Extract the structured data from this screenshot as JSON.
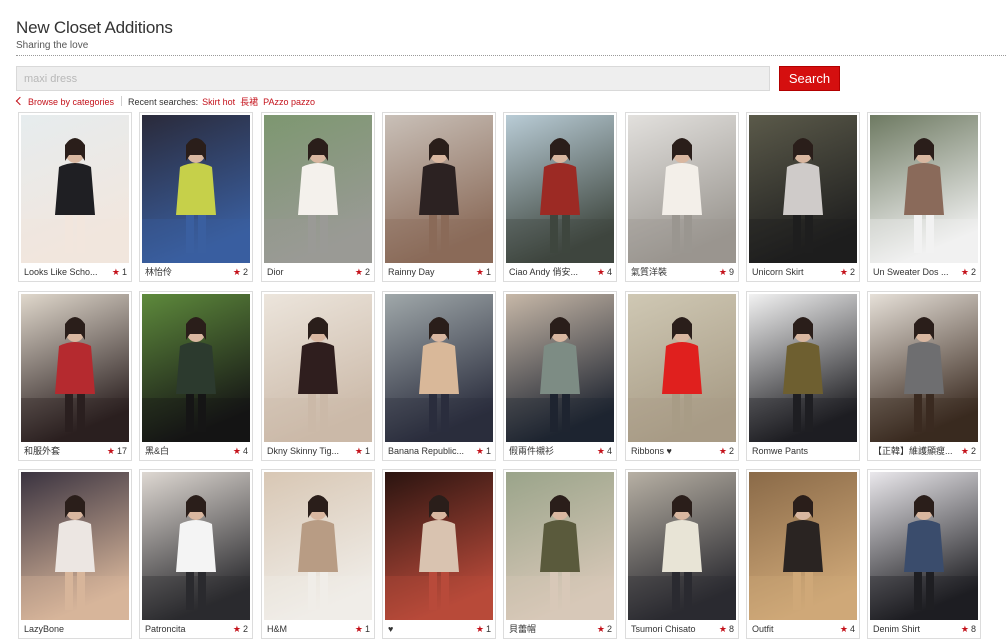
{
  "header": {
    "title": "New Closet Additions",
    "subtitle": "Sharing the love"
  },
  "search": {
    "value": "",
    "placeholder": "maxi dress",
    "button_label": "Search"
  },
  "nav": {
    "browse_label": "Browse by categories",
    "recent_label": "Recent searches:",
    "recent": [
      "Skirt hot",
      "長裙",
      "PAzzo pazzo"
    ]
  },
  "colors": {
    "accent": "#d50f0f",
    "link": "#c4121b",
    "star": "#c4121b"
  },
  "items": [
    {
      "title": "Looks Like Scho...",
      "count": "1",
      "palette": [
        "#e6ecee",
        "#1f1f23",
        "#f2e6dd"
      ]
    },
    {
      "title": "林怡伶",
      "count": "2",
      "palette": [
        "#2a2a3a",
        "#c6d04a",
        "#3a5fa0"
      ]
    },
    {
      "title": "Dior",
      "count": "2",
      "palette": [
        "#7d9770",
        "#f4f1ec",
        "#9a9a96"
      ]
    },
    {
      "title": "Rainny Day",
      "count": "1",
      "palette": [
        "#c9c0b8",
        "#2c2222",
        "#8a6a58"
      ]
    },
    {
      "title": "Ciao Andy 俏安...",
      "count": "4",
      "palette": [
        "#b9ccd6",
        "#9c2a24",
        "#3e463e"
      ]
    },
    {
      "title": "氣質洋裝",
      "count": "9",
      "palette": [
        "#e2e0dd",
        "#f3efe9",
        "#9a9690"
      ]
    },
    {
      "title": "Unicorn Skirt",
      "count": "2",
      "palette": [
        "#5b5a4a",
        "#cfcbc9",
        "#1e1e1e"
      ]
    },
    {
      "title": "Un Sweater Dos ...",
      "count": "2",
      "palette": [
        "#6e7a62",
        "#8a6a5a",
        "#f2f2f2"
      ]
    },
    {
      "title": "和服外套",
      "count": "17",
      "palette": [
        "#e0d8cc",
        "#b52a2f",
        "#2a1f1f"
      ]
    },
    {
      "title": "黑&白",
      "count": "4",
      "palette": [
        "#5e8a3c",
        "#2c3a2e",
        "#151515"
      ]
    },
    {
      "title": "Dkny Skinny Tig...",
      "count": "1",
      "palette": [
        "#ece5dc",
        "#2f1e1e",
        "#cbb9a8"
      ]
    },
    {
      "title": "Banana Republic...",
      "count": "1",
      "palette": [
        "#a0a8aa",
        "#d9b899",
        "#2a2d3d"
      ]
    },
    {
      "title": "假兩件襯衫",
      "count": "4",
      "palette": [
        "#c7b8a8",
        "#7d8c84",
        "#1e2430"
      ]
    },
    {
      "title": "Ribbons ♥",
      "count": "2",
      "palette": [
        "#cfc8b4",
        "#e0201e",
        "#a89c86"
      ]
    },
    {
      "title": "Romwe Pants",
      "count": "",
      "palette": [
        "#f2f2f2",
        "#6e5f30",
        "#1e1e22"
      ]
    },
    {
      "title": "【正韓】維護顯瘦...",
      "count": "2",
      "palette": [
        "#e6e0d8",
        "#6e6e70",
        "#3a2a20"
      ]
    },
    {
      "title": "LazyBone",
      "count": "",
      "palette": [
        "#3a3340",
        "#ece6e2",
        "#d7b59a"
      ]
    },
    {
      "title": "Patroncita",
      "count": "2",
      "palette": [
        "#ded8d2",
        "#f4f4f4",
        "#2a2a2e"
      ]
    },
    {
      "title": "H&M",
      "count": "1",
      "palette": [
        "#d8c7b4",
        "#b89c84",
        "#f0ede8"
      ]
    },
    {
      "title": "♥",
      "count": "1",
      "palette": [
        "#2a1410",
        "#d9c3b0",
        "#b84a3a"
      ]
    },
    {
      "title": "貝蕾帽",
      "count": "2",
      "palette": [
        "#9aa48a",
        "#5a5a3c",
        "#d8c8b8"
      ]
    },
    {
      "title": "Tsumori Chisato",
      "count": "8",
      "palette": [
        "#b7b0a4",
        "#e8e4d6",
        "#2a2a30"
      ]
    },
    {
      "title": "Outfit",
      "count": "4",
      "palette": [
        "#8a6a48",
        "#2a2422",
        "#cfa878"
      ]
    },
    {
      "title": "Denim Shirt",
      "count": "8",
      "palette": [
        "#eae8ec",
        "#3a4c6c",
        "#1e1e22"
      ]
    }
  ]
}
